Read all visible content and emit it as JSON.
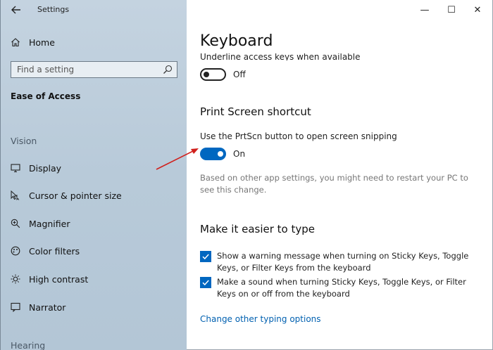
{
  "window": {
    "app_title": "Settings",
    "back_icon": "back-arrow-icon",
    "minimize_glyph": "—",
    "maximize_glyph": "☐",
    "close_glyph": "✕"
  },
  "sidebar": {
    "home_label": "Home",
    "search_placeholder": "Find a setting",
    "section_title": "Ease of Access",
    "group_vision": "Vision",
    "group_hearing": "Hearing",
    "items": [
      {
        "label": "Display",
        "icon": "display-icon"
      },
      {
        "label": "Cursor & pointer size",
        "icon": "cursor-icon"
      },
      {
        "label": "Magnifier",
        "icon": "magnifier-icon"
      },
      {
        "label": "Color filters",
        "icon": "color-filters-icon"
      },
      {
        "label": "High contrast",
        "icon": "high-contrast-icon"
      },
      {
        "label": "Narrator",
        "icon": "narrator-icon"
      }
    ]
  },
  "main": {
    "page_title": "Keyboard",
    "underline": {
      "label": "Underline access keys when available",
      "state_label": "Off",
      "state": "off"
    },
    "print_screen": {
      "heading": "Print Screen shortcut",
      "label": "Use the PrtScn button to open screen snipping",
      "state_label": "On",
      "state": "on",
      "note": "Based on other app settings, you might need to restart your PC to see this change."
    },
    "typing": {
      "heading": "Make it easier to type",
      "checkbox1": "Show a warning message when turning on Sticky Keys, Toggle Keys, or Filter Keys from the keyboard",
      "checkbox2": "Make a sound when turning Sticky Keys, Toggle Keys, or Filter Keys on or off from the keyboard",
      "checkbox1_checked": true,
      "checkbox2_checked": true,
      "link": "Change other typing options"
    }
  },
  "colors": {
    "accent": "#0067c0",
    "link": "#0060b0",
    "annotation_arrow": "#d0201c"
  }
}
